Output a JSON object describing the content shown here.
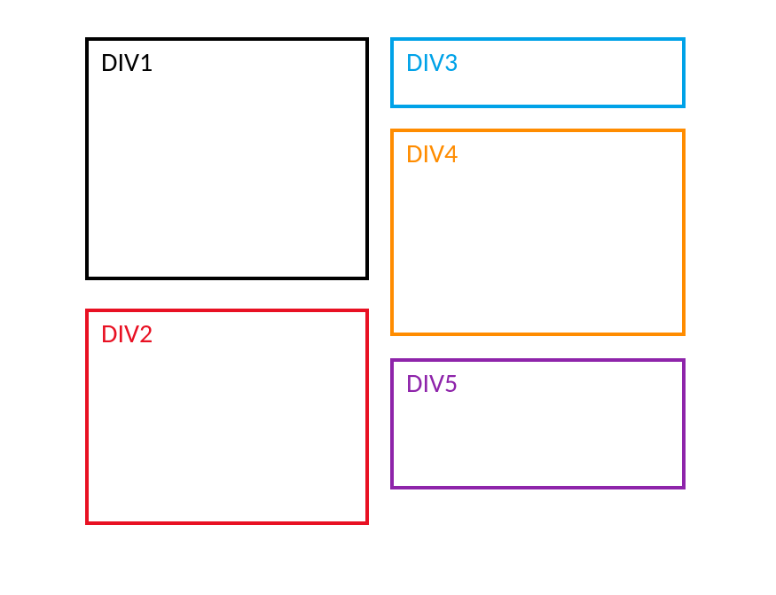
{
  "boxes": {
    "div1": {
      "label": "DIV1",
      "color": "#000000"
    },
    "div2": {
      "label": "DIV2",
      "color": "#e81123"
    },
    "div3": {
      "label": "DIV3",
      "color": "#00a2e8"
    },
    "div4": {
      "label": "DIV4",
      "color": "#ff8c00"
    },
    "div5": {
      "label": "DIV5",
      "color": "#8e24aa"
    }
  }
}
